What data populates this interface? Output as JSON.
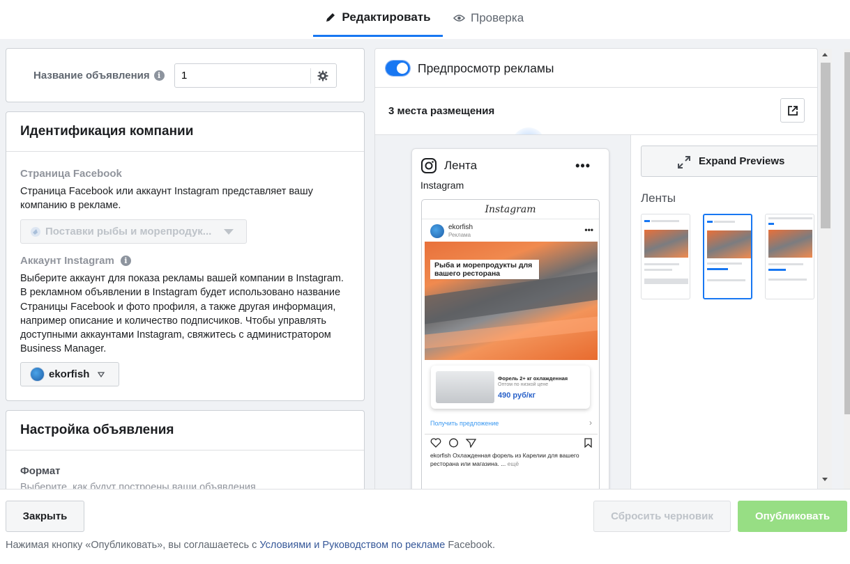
{
  "tabs": {
    "edit": "Редактировать",
    "review": "Проверка"
  },
  "ad_name": {
    "label": "Название объявления",
    "value": "1"
  },
  "identity": {
    "title": "Идентификация компании",
    "fb_page_title": "Страница Facebook",
    "fb_page_desc": "Страница Facebook или аккаунт Instagram представляет вашу компанию в рекламе.",
    "fb_page_value": "Поставки рыбы и морепродук...",
    "ig_title": "Аккаунт Instagram",
    "ig_desc": "Выберите аккаунт для показа рекламы вашей компании в Instagram. В рекламном объявлении в Instagram будет использовано название Страницы Facebook и фото профиля, а также другая информация, например описание и количество подписчиков. Чтобы управлять доступными аккаунтами Instagram, свяжитесь с администратором Business Manager.",
    "ig_value": "ekorfish"
  },
  "setup": {
    "title": "Настройка объявления",
    "format_label": "Формат",
    "format_desc": "Выберите, как будут построены ваши объявления."
  },
  "preview": {
    "toggle_label": "Предпросмотр рекламы",
    "placements": "3 места размещения",
    "phone_title": "Лента",
    "phone_platform": "Instagram",
    "ig_logo": "Instagram",
    "post_account": "ekorfish",
    "post_sponsored": "Реклама",
    "banner_text": "Рыба и морепродукты для вашего ресторана",
    "offer_title": "Форель 2+ кг охлажденная",
    "offer_sub": "Оптом по низкой цене",
    "offer_price": "490 руб/кг",
    "cta": "Получить предложение",
    "caption_name": "ekorfish",
    "caption_text": " Охлажденная форель из Карелии для вашего ресторана или магазина. ...",
    "caption_more": " ещё",
    "expand_label": "Expand Previews",
    "feeds_label": "Ленты"
  },
  "footer": {
    "close": "Закрыть",
    "reset": "Сбросить черновик",
    "publish": "Опубликовать",
    "terms_pre": "Нажимая кнопку «Опубликовать», вы соглашаетесь с ",
    "terms_link": "Условиями и Руководством по рекламе",
    "terms_post": " Facebook."
  },
  "colors": {
    "accent": "#1877f2",
    "publish_bg": "#97de84",
    "link": "#365899"
  }
}
